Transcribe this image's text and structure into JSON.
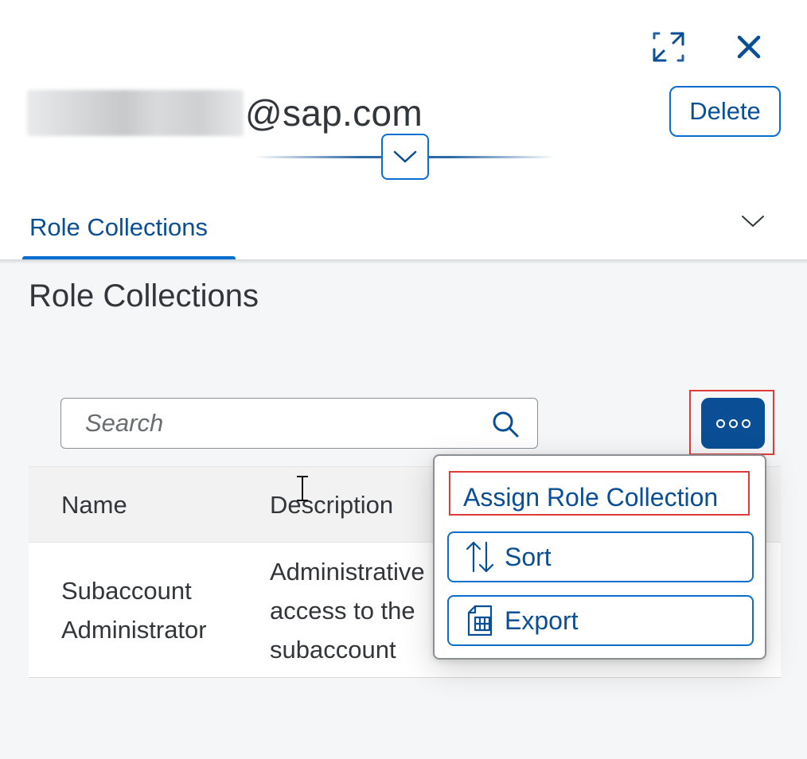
{
  "header": {
    "title_suffix": "@sap.com",
    "delete_label": "Delete",
    "tab_label": "Role Collections"
  },
  "section": {
    "title": "Role Collections"
  },
  "search": {
    "placeholder": "Search"
  },
  "table": {
    "columns": [
      "Name",
      "Description"
    ],
    "rows": [
      {
        "name": "Subaccount Administrator",
        "description": "Administrative access to the subaccount"
      }
    ]
  },
  "menu": {
    "items": [
      {
        "label": "Assign Role Collection",
        "icon": ""
      },
      {
        "label": "Sort",
        "icon": "sort-icon"
      },
      {
        "label": "Export",
        "icon": "export-table-icon"
      }
    ]
  },
  "colors": {
    "accent": "#0a6ed1",
    "accent_dark": "#0a4f95",
    "highlight": "#e03a3a"
  }
}
